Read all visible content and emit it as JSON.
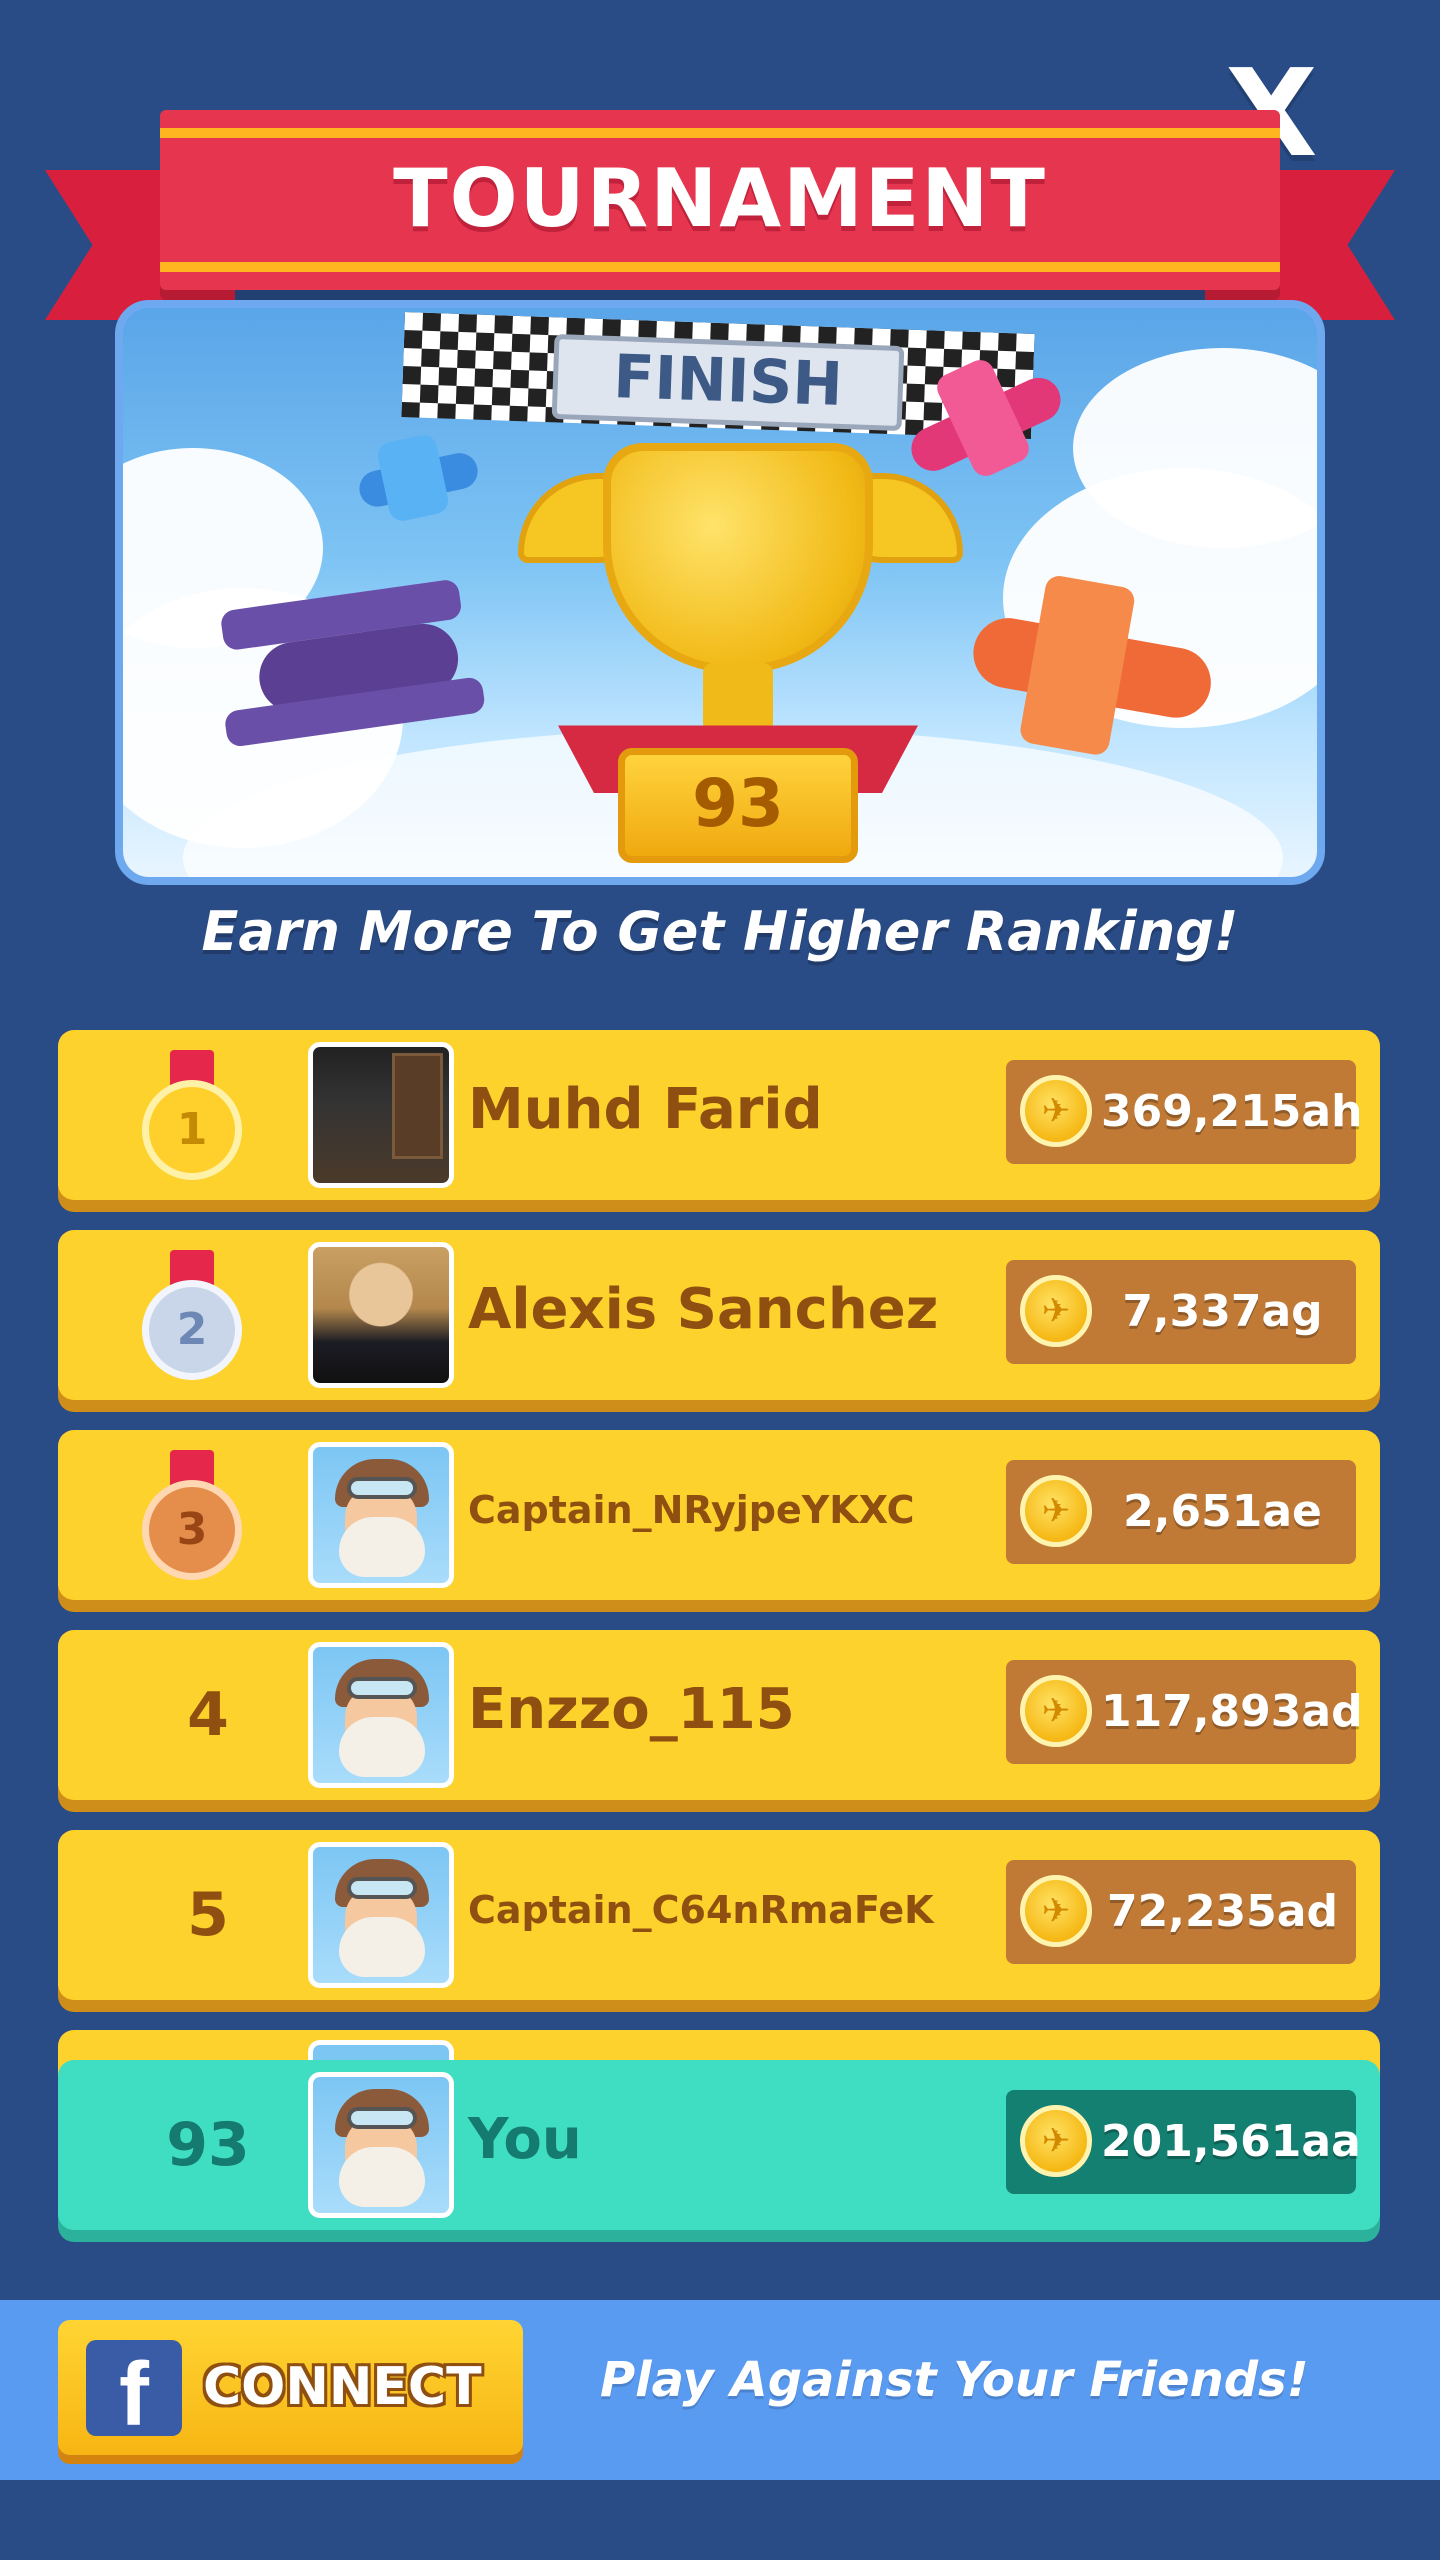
{
  "header": {
    "close_label": "X",
    "title": "TOURNAMENT"
  },
  "scene": {
    "finish_label": "FINISH",
    "trophy_rank": "93"
  },
  "subtitle": "Earn More To Get Higher Ranking!",
  "leaderboard": [
    {
      "rank": "1",
      "medal": "gold",
      "name": "Muhd Farid",
      "score": "369,215ah",
      "avatar": "game-screenshot"
    },
    {
      "rank": "2",
      "medal": "silver",
      "name": "Alexis Sanchez",
      "score": "7,337ag",
      "avatar": "photo"
    },
    {
      "rank": "3",
      "medal": "bronze",
      "name": "Captain_NRyjpeYKXC",
      "score": "2,651ae",
      "avatar": "pilot"
    },
    {
      "rank": "4",
      "medal": "",
      "name": "Enzzo_115",
      "score": "117,893ad",
      "avatar": "pilot"
    },
    {
      "rank": "5",
      "medal": "",
      "name": "Captain_C64nRmaFeK",
      "score": "72,235ad",
      "avatar": "pilot"
    }
  ],
  "you_row": {
    "rank": "93",
    "name": "You",
    "score": "201,561aa",
    "avatar": "pilot"
  },
  "footer": {
    "connect_label": "CONNECT",
    "fb_glyph": "f",
    "friends_text": "Play Against Your Friends!"
  },
  "icons": {
    "coin": "coin-icon",
    "close": "close-icon",
    "facebook": "facebook-icon"
  },
  "colors": {
    "background": "#2a4c86",
    "row_yellow": "#fdd22c",
    "row_you": "#3fdec3",
    "ribbon_red": "#e5354f",
    "score_box": "#c07a36",
    "footer_blue": "#5a9bf2"
  }
}
